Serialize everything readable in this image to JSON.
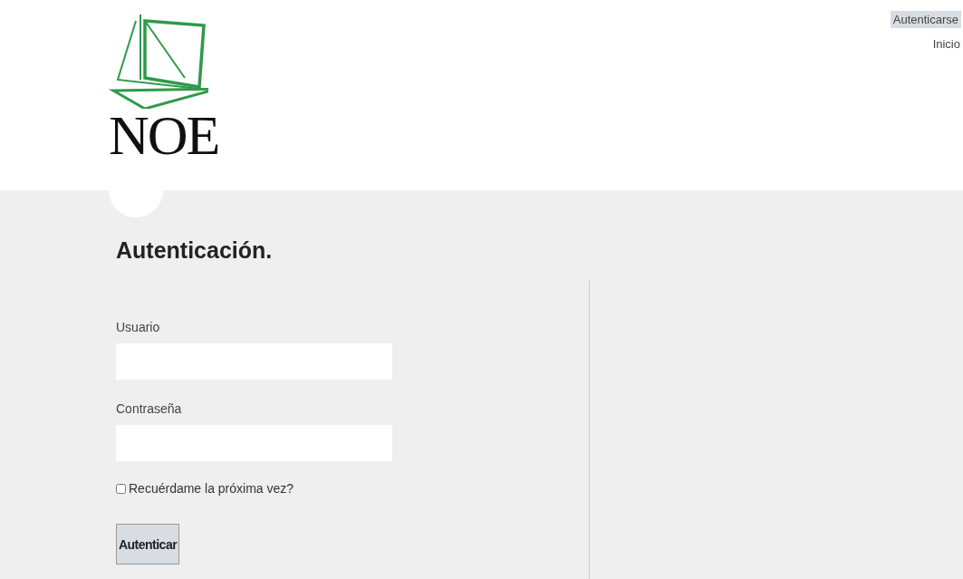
{
  "logo": {
    "text": "NOE"
  },
  "nav": [
    {
      "label": "Autenticarse",
      "selected": true
    },
    {
      "label": "Inicio",
      "selected": false
    }
  ],
  "login": {
    "heading": "Autenticación.",
    "fields": [
      {
        "label": "Usuario"
      },
      {
        "label": "Contraseña"
      }
    ],
    "remember": {
      "label": "Recuérdame la próxima vez?",
      "checked": false
    },
    "submit": "Autenticar"
  }
}
